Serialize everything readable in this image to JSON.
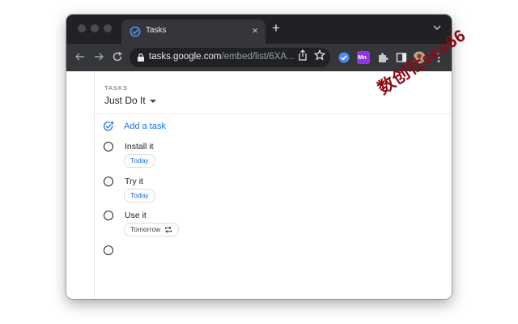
{
  "browser": {
    "tab_title": "Tasks",
    "tab_close": "×",
    "new_tab": "+",
    "url_host": "tasks.google.com",
    "url_path": "/embed/list/6XA...",
    "icons": [
      "back-icon",
      "forward-icon",
      "reload-icon",
      "lock-icon",
      "share-icon",
      "star-icon",
      "tasks-extension-icon",
      "mn-extension-icon",
      "puzzle-extensions-icon",
      "side-panel-icon",
      "profile-avatar",
      "kebab-menu-icon"
    ],
    "mn_badge": "Mn"
  },
  "app": {
    "section_label": "TASKS",
    "list_title": "Just Do It",
    "add_task_label": "Add a task",
    "accent": "#1a73e8",
    "tasks": [
      {
        "title": "Install it",
        "due": "Today"
      },
      {
        "title": "Try it",
        "due": "Today"
      },
      {
        "title": "Use it",
        "due": "Tomorrow",
        "repeat": true
      }
    ]
  },
  "watermark": "数创社scs66"
}
